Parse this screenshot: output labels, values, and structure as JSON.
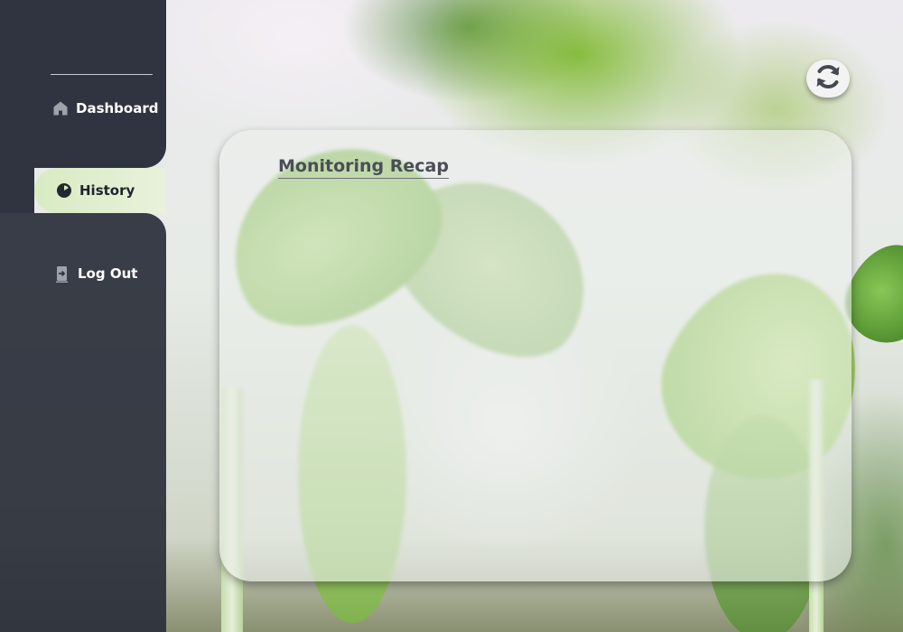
{
  "sidebar": {
    "items": [
      {
        "label": "Dashboard",
        "icon": "home-icon"
      },
      {
        "label": "History",
        "icon": "history-icon",
        "active": true
      },
      {
        "label": "Log Out",
        "icon": "logout-icon"
      }
    ]
  },
  "toolbar": {
    "refresh_icon": "refresh-icon"
  },
  "main": {
    "title": "Monitoring Recap"
  },
  "colors": {
    "sidebar_bg": "#303440",
    "active_item_bg": "#d8ebc2",
    "title_text": "#4a4e55"
  }
}
